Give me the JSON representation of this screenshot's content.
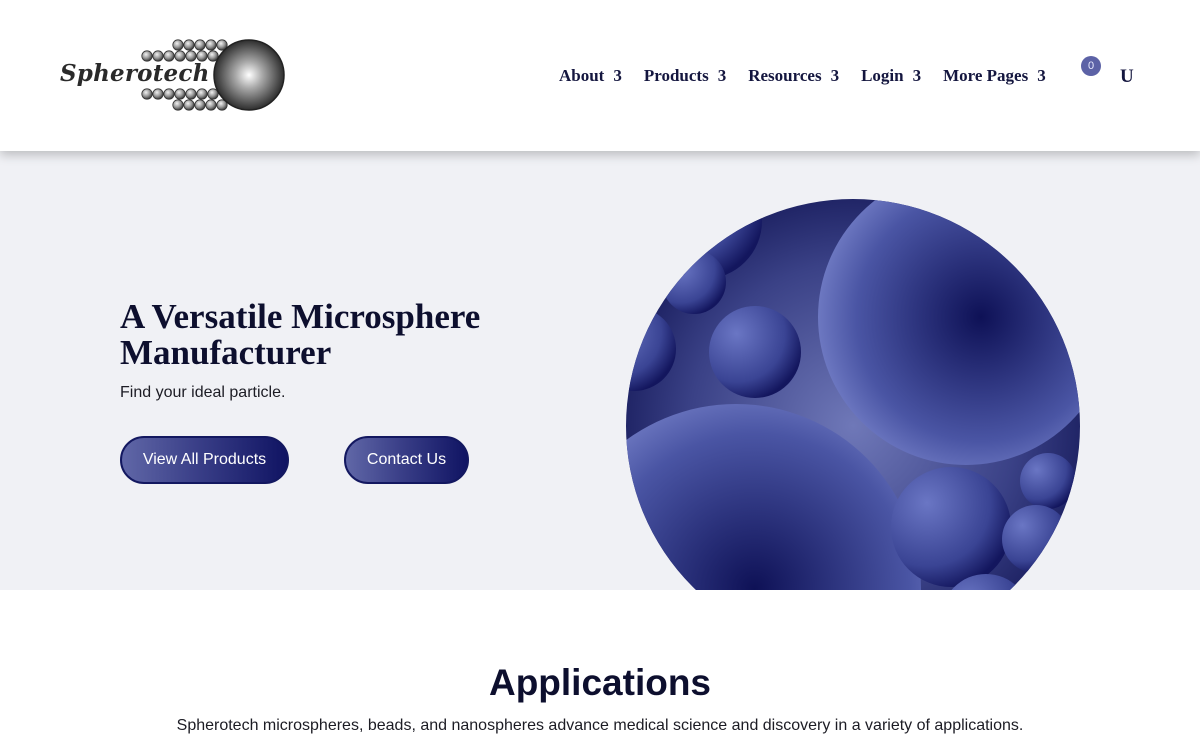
{
  "brand": {
    "name": "Spherotech"
  },
  "nav": {
    "items": [
      {
        "label": "About",
        "arrow": "3"
      },
      {
        "label": "Products",
        "arrow": "3"
      },
      {
        "label": "Resources",
        "arrow": "3"
      },
      {
        "label": "Login",
        "arrow": "3"
      },
      {
        "label": "More Pages",
        "arrow": "3"
      }
    ],
    "cart_count": "0",
    "user_icon": "U"
  },
  "hero": {
    "title": "A Versatile Microsphere Manufacturer",
    "subtitle": "Find your ideal particle.",
    "primary_button": "View All Products",
    "secondary_button": "Contact Us"
  },
  "applications": {
    "title": "Applications",
    "description": "Spherotech microspheres, beads, and nanospheres advance medical science and discovery in a variety of applications."
  },
  "colors": {
    "navy": "#14163f",
    "accent": "#5c62a6",
    "hero_bg": "#f0f1f5",
    "button_dark": "#101463"
  },
  "icons": {
    "cart": "cart-icon",
    "user": "user-icon",
    "dropdown": "chevron-down-icon"
  }
}
